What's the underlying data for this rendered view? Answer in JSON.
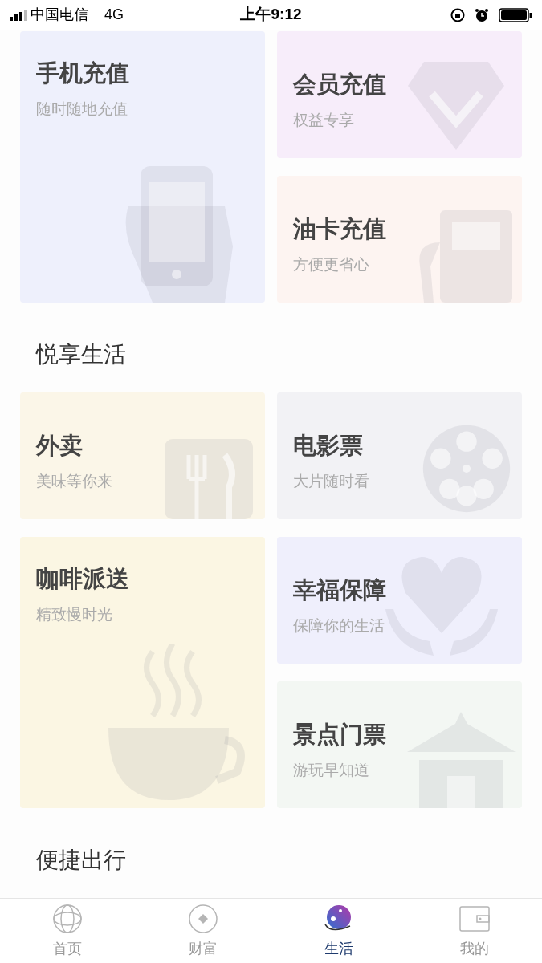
{
  "status_bar": {
    "carrier": "中国电信",
    "network": "4G",
    "time": "上午9:12"
  },
  "sections": [
    {
      "cards": [
        {
          "title": "手机充值",
          "subtitle": "随时随地充值",
          "kind": "phone",
          "tall": true,
          "color": "#eef0fc"
        },
        {
          "title": "会员充值",
          "subtitle": "权益专享",
          "kind": "diamond",
          "tall": false,
          "color": "#f7edfa"
        },
        {
          "title": "油卡充值",
          "subtitle": "方便更省心",
          "kind": "fuel",
          "tall": false,
          "color": "#fdf4f1"
        }
      ]
    },
    {
      "title": "悦享生活",
      "cards": [
        {
          "title": "外卖",
          "subtitle": "美味等你来",
          "kind": "dining",
          "tall": false,
          "color": "#fbf6e8"
        },
        {
          "title": "电影票",
          "subtitle": "大片随时看",
          "kind": "film",
          "tall": false,
          "color": "#f2f2f5"
        },
        {
          "title": "咖啡派送",
          "subtitle": "精致慢时光",
          "kind": "coffee",
          "tall": true,
          "color": "#fbf6e3"
        },
        {
          "title": "幸福保障",
          "subtitle": "保障你的生活",
          "kind": "heart",
          "tall": false,
          "color": "#efeffc"
        },
        {
          "title": "景点门票",
          "subtitle": "游玩早知道",
          "kind": "temple",
          "tall": false,
          "color": "#f3f7f3"
        }
      ]
    },
    {
      "title": "便捷出行"
    }
  ],
  "tab_bar": [
    {
      "label": "首页",
      "kind": "globe",
      "selected": false
    },
    {
      "label": "财富",
      "kind": "coin",
      "selected": false
    },
    {
      "label": "生活",
      "kind": "planet",
      "selected": true
    },
    {
      "label": "我的",
      "kind": "wallet",
      "selected": false
    }
  ]
}
